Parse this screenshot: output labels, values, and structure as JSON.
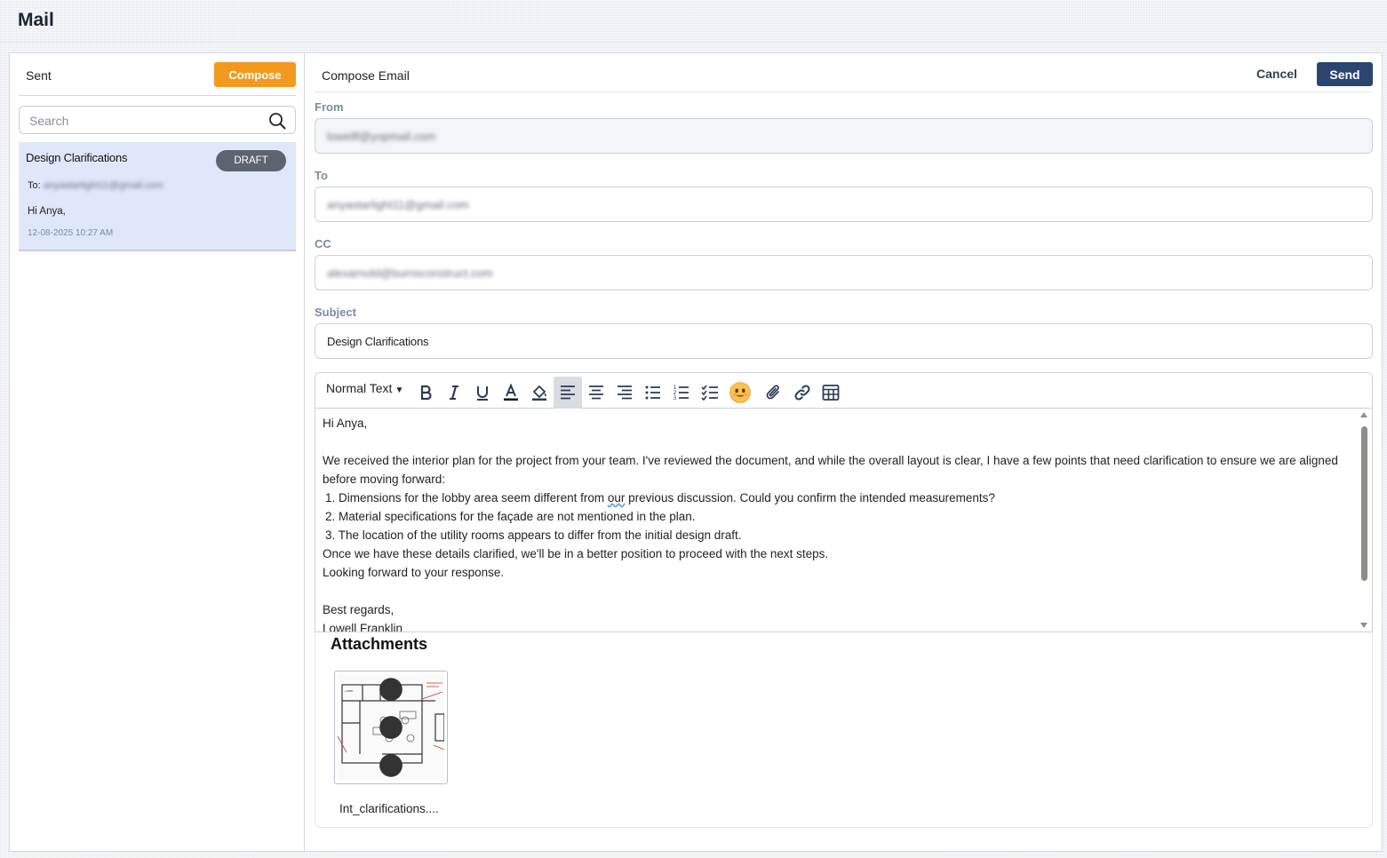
{
  "app": {
    "title": "Mail"
  },
  "left": {
    "folder_label": "Sent",
    "compose_label": "Compose",
    "search": {
      "placeholder": "Search"
    },
    "mail_items": [
      {
        "subject": "Design Clarifications",
        "badge": "DRAFT",
        "to_label": "To:",
        "to": "anyastarlight11@gmail.com",
        "preview": "Hi Anya,",
        "date": "12-08-2025 10:27 AM"
      }
    ]
  },
  "compose": {
    "title": "Compose Email",
    "cancel_label": "Cancel",
    "send_label": "Send",
    "from": {
      "label": "From",
      "value": "lowellf@yopmail.com"
    },
    "to": {
      "label": "To",
      "value": "anyastarlight11@gmail.com"
    },
    "cc": {
      "label": "CC",
      "value": "alexarnold@burnsconstruct.com"
    },
    "subject": {
      "label": "Subject",
      "value": "Design Clarifications"
    },
    "toolbar": {
      "text_style": "Normal Text",
      "buttons": [
        "bold-icon",
        "italic-icon",
        "underline-icon",
        "text-color-icon",
        "highlight-icon",
        "align-left-icon",
        "align-center-icon",
        "align-right-icon",
        "bullet-list-icon",
        "numbered-list-icon",
        "checklist-icon",
        "emoji-icon",
        "attach-icon",
        "link-icon",
        "table-icon"
      ],
      "active": "align-left-icon"
    },
    "body": {
      "greeting": "Hi Anya,",
      "intro": "We received the interior plan for the project from your team. I've reviewed the document, and while the overall layout is clear, I have a few points that need clarification to ensure we are aligned before moving forward:",
      "item1_pre": "1. Dimensions for the lobby area seem different from ",
      "item1_word": "our",
      "item1_post": " previous discussion. Could you confirm the intended measurements?",
      "item2": "2. Material specifications for the façade are not mentioned in the plan.",
      "item3": "3. The location of the utility rooms appears to differ from the initial design draft.",
      "outro1": "Once we have these details clarified, we'll be in a better position to proceed with the next steps.",
      "outro2": "Looking forward to your response.",
      "closing": "Best regards,",
      "signature": "Lowell Franklin"
    },
    "attachments": {
      "title": "Attachments",
      "files": [
        {
          "name": "Int_clarifications...."
        }
      ]
    }
  },
  "colors": {
    "compose_button": "#f39a1e",
    "send_button": "#2b4470",
    "selected_item_bg": "#dfe7fa",
    "draft_badge": "#5c6371",
    "label_color": "#7b8aa8"
  }
}
